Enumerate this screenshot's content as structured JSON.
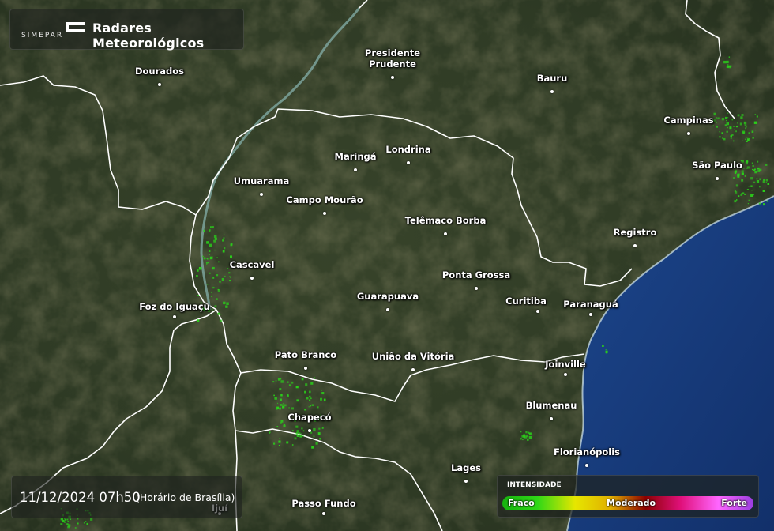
{
  "header": {
    "logo_text": "SIMEPAR",
    "title": "Radares Meteorológicos"
  },
  "timestamp": {
    "datetime": "11/12/2024 07h50",
    "timezone": "(Horário de Brasília)"
  },
  "legend": {
    "title": "INTENSIDADE",
    "labels": {
      "weak": "Fraco",
      "moderate": "Moderado",
      "strong": "Forte"
    },
    "gradient_colors": [
      "#17b20f",
      "#2fd816",
      "#e6e600",
      "#e0b000",
      "#8c0000",
      "#e0107a",
      "#ff66ff",
      "#9a3de0"
    ]
  },
  "map": {
    "colors": {
      "land": "#303b25",
      "ocean": "#1c468c",
      "ocean_deep": "#12306a",
      "border": "#ffffff",
      "river": "#7fa9a2",
      "radar_weak": "#2ad11a"
    },
    "cities": [
      {
        "id": "dourados",
        "name": "Dourados"
      },
      {
        "id": "presidente-prudente",
        "name": "Presidente\nPrudente"
      },
      {
        "id": "bauru",
        "name": "Bauru"
      },
      {
        "id": "campinas",
        "name": "Campinas"
      },
      {
        "id": "sao-paulo",
        "name": "São Paulo"
      },
      {
        "id": "londrina",
        "name": "Londrina"
      },
      {
        "id": "maringa",
        "name": "Maringá"
      },
      {
        "id": "umuarama",
        "name": "Umuarama"
      },
      {
        "id": "campo-mourao",
        "name": "Campo Mourão"
      },
      {
        "id": "telemaco-borba",
        "name": "Telêmaco Borba"
      },
      {
        "id": "registro",
        "name": "Registro"
      },
      {
        "id": "cascavel",
        "name": "Cascavel"
      },
      {
        "id": "ponta-grossa",
        "name": "Ponta Grossa"
      },
      {
        "id": "foz-do-iguacu",
        "name": "Foz do Iguaçu"
      },
      {
        "id": "guarapuava",
        "name": "Guarapuava"
      },
      {
        "id": "curitiba",
        "name": "Curitiba"
      },
      {
        "id": "paranagua",
        "name": "Paranaguá"
      },
      {
        "id": "pato-branco",
        "name": "Pato Branco"
      },
      {
        "id": "uniao-da-vitoria",
        "name": "União da Vitória"
      },
      {
        "id": "joinville",
        "name": "Joinville"
      },
      {
        "id": "blumenau",
        "name": "Blumenau"
      },
      {
        "id": "chapeco",
        "name": "Chapecó"
      },
      {
        "id": "florianopolis",
        "name": "Florianópolis"
      },
      {
        "id": "lages",
        "name": "Lages"
      },
      {
        "id": "passo-fundo",
        "name": "Passo Fundo"
      },
      {
        "id": "ijui",
        "name": "Ijuí"
      }
    ]
  }
}
